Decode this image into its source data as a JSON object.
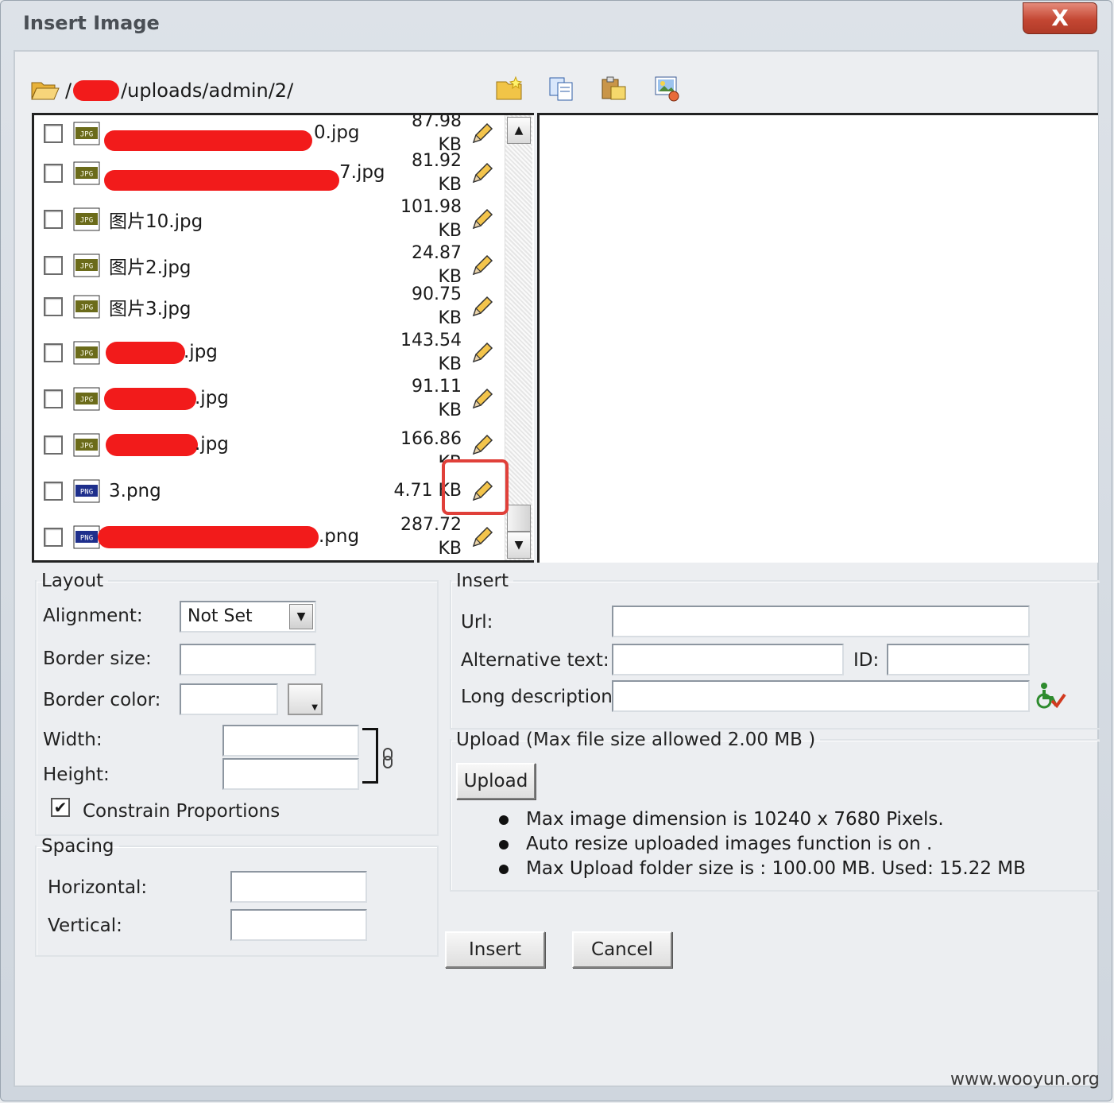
{
  "window": {
    "title": "Insert Image",
    "close_label": "X"
  },
  "path": {
    "prefix": "/",
    "text": "/uploads/admin/2/"
  },
  "toolbar": {
    "icons": [
      "new-folder-icon",
      "copy-icon",
      "paste-icon",
      "image-editor-icon"
    ]
  },
  "files": [
    {
      "name": "0.jpg",
      "size": "87.98 KB",
      "type": "JPG"
    },
    {
      "name": "7.jpg",
      "size": "81.92 KB",
      "type": "JPG"
    },
    {
      "name": "图片10.jpg",
      "size_line1": "101.98",
      "size_line2": "KB",
      "type": "JPG"
    },
    {
      "name": "图片2.jpg",
      "size": "24.87 KB",
      "type": "JPG"
    },
    {
      "name": "图片3.jpg",
      "size": "90.75 KB",
      "type": "JPG"
    },
    {
      "name": ".jpg",
      "size_line1": "143.54",
      "size_line2": "KB",
      "type": "JPG"
    },
    {
      "name": ".jpg",
      "size": "91.11 KB",
      "type": "JPG"
    },
    {
      "name": ".jpg",
      "size_line1": "166.86",
      "size_line2": "KB",
      "type": "JPG"
    },
    {
      "name": "3.png",
      "size": "4.71 KB",
      "type": "PNG"
    },
    {
      "name": ".png",
      "size_line1": "287.72",
      "size_line2": "KB",
      "type": "PNG"
    }
  ],
  "layout": {
    "legend": "Layout",
    "alignment_label": "Alignment:",
    "alignment_value": "Not Set",
    "border_size_label": "Border size:",
    "border_color_label": "Border color:",
    "width_label": "Width:",
    "height_label": "Height:",
    "constrain_label": "Constrain Proportions",
    "constrain_checked": true
  },
  "spacing": {
    "legend": "Spacing",
    "horizontal_label": "Horizontal:",
    "vertical_label": "Vertical:"
  },
  "insert": {
    "legend": "Insert",
    "url_label": "Url:",
    "alt_label": "Alternative text:",
    "id_label": "ID:",
    "longdesc_label": "Long description:"
  },
  "upload": {
    "legend": "Upload (Max file size allowed 2.00 MB )",
    "button": "Upload",
    "notes": [
      "Max image dimension is 10240 x 7680 Pixels.",
      "Auto resize uploaded images function is on .",
      "Max Upload folder size is : 100.00 MB. Used: 15.22 MB"
    ]
  },
  "actions": {
    "insert": "Insert",
    "cancel": "Cancel"
  },
  "watermark": "www.wooyun.org",
  "colors": {
    "redaction": "#f21b1b",
    "highlight": "#e0403a",
    "jpg_icon": "#6b6b1a",
    "png_icon": "#1e2f8c"
  }
}
